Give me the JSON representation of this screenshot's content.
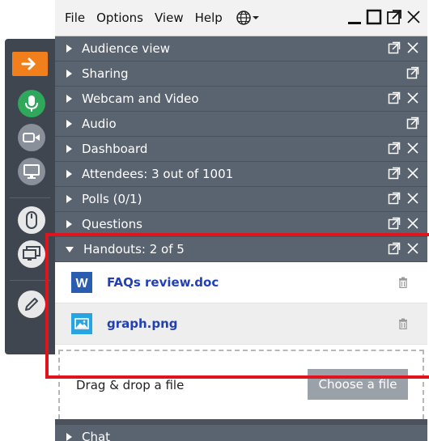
{
  "menubar": {
    "items": [
      "File",
      "Options",
      "View",
      "Help"
    ]
  },
  "panes": [
    {
      "label": "Audience view",
      "controls": [
        "popout",
        "close"
      ]
    },
    {
      "label": "Sharing",
      "controls": [
        "popout"
      ]
    },
    {
      "label": "Webcam and Video",
      "controls": [
        "popout",
        "close"
      ]
    },
    {
      "label": "Audio",
      "controls": [
        "popout"
      ]
    },
    {
      "label": "Dashboard",
      "controls": [
        "popout",
        "close"
      ]
    },
    {
      "label": "Attendees:  3 out of 1001",
      "controls": [
        "popout",
        "close"
      ]
    },
    {
      "label": "Polls (0/1)",
      "controls": [
        "popout",
        "close"
      ]
    },
    {
      "label": "Questions",
      "controls": [
        "popout",
        "close"
      ]
    }
  ],
  "handouts": {
    "label": "Handouts: 2 of 5",
    "files": [
      {
        "name": "FAQs review.doc",
        "type": "word"
      },
      {
        "name": "graph.png",
        "type": "image"
      }
    ],
    "drop_text": "Drag & drop a file",
    "choose_label": "Choose a file"
  },
  "chat": {
    "label": "Chat"
  },
  "colors": {
    "orange": "#f07f1c",
    "green": "#2fa85b",
    "highlight": "#e0141c",
    "link": "#2140b8"
  }
}
